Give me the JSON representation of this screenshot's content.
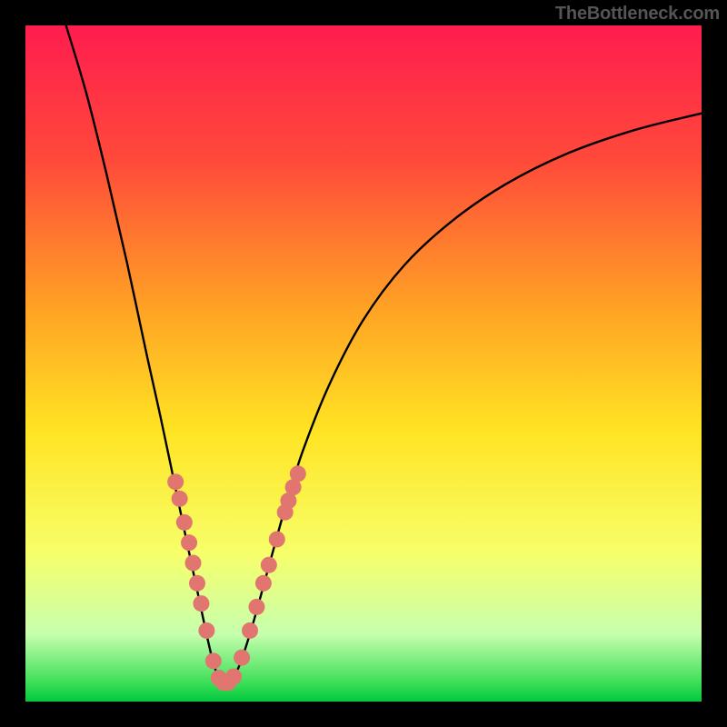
{
  "watermark": "TheBottleneck.com",
  "chart_data": {
    "type": "line",
    "title": "",
    "xlabel": "",
    "ylabel": "",
    "xlim": [
      0,
      100
    ],
    "ylim": [
      0,
      100
    ],
    "background_gradient": {
      "stops": [
        {
          "offset": 0,
          "color": "#ff1c4f"
        },
        {
          "offset": 20,
          "color": "#ff4a3a"
        },
        {
          "offset": 42,
          "color": "#ffa324"
        },
        {
          "offset": 60,
          "color": "#ffe423"
        },
        {
          "offset": 78,
          "color": "#f7ff6a"
        },
        {
          "offset": 90,
          "color": "#c7ffae"
        },
        {
          "offset": 97,
          "color": "#41e05a"
        },
        {
          "offset": 100,
          "color": "#00c93e"
        }
      ]
    },
    "curve": {
      "note": "Single V-shaped curve; y plotted with origin at top (0=top, 100=bottom). Minimum ~x=29.",
      "points": [
        {
          "x": 6.0,
          "y": 0.0
        },
        {
          "x": 9.0,
          "y": 10.0
        },
        {
          "x": 12.0,
          "y": 22.0
        },
        {
          "x": 15.0,
          "y": 35.0
        },
        {
          "x": 18.0,
          "y": 49.0
        },
        {
          "x": 20.0,
          "y": 58.0
        },
        {
          "x": 22.0,
          "y": 67.5
        },
        {
          "x": 24.0,
          "y": 77.0
        },
        {
          "x": 25.5,
          "y": 84.0
        },
        {
          "x": 27.0,
          "y": 91.0
        },
        {
          "x": 28.0,
          "y": 95.0
        },
        {
          "x": 29.0,
          "y": 97.0
        },
        {
          "x": 30.0,
          "y": 97.0
        },
        {
          "x": 31.5,
          "y": 95.0
        },
        {
          "x": 33.5,
          "y": 89.0
        },
        {
          "x": 36.0,
          "y": 80.0
        },
        {
          "x": 38.5,
          "y": 71.0
        },
        {
          "x": 41.0,
          "y": 63.0
        },
        {
          "x": 45.0,
          "y": 53.0
        },
        {
          "x": 50.0,
          "y": 43.5
        },
        {
          "x": 56.0,
          "y": 35.5
        },
        {
          "x": 63.0,
          "y": 29.0
        },
        {
          "x": 71.0,
          "y": 23.5
        },
        {
          "x": 80.0,
          "y": 19.0
        },
        {
          "x": 90.0,
          "y": 15.5
        },
        {
          "x": 100.0,
          "y": 13.0
        }
      ]
    },
    "markers": {
      "color": "#e0766f",
      "radius_px": 9,
      "points": [
        {
          "x": 22.2,
          "y": 67.5
        },
        {
          "x": 22.8,
          "y": 70.0
        },
        {
          "x": 23.5,
          "y": 73.5
        },
        {
          "x": 24.2,
          "y": 76.5
        },
        {
          "x": 24.8,
          "y": 79.5
        },
        {
          "x": 25.4,
          "y": 82.5
        },
        {
          "x": 26.0,
          "y": 85.5
        },
        {
          "x": 26.8,
          "y": 89.5
        },
        {
          "x": 27.8,
          "y": 94.0
        },
        {
          "x": 28.6,
          "y": 96.5
        },
        {
          "x": 29.3,
          "y": 97.2
        },
        {
          "x": 30.0,
          "y": 97.2
        },
        {
          "x": 30.8,
          "y": 96.3
        },
        {
          "x": 32.0,
          "y": 93.5
        },
        {
          "x": 33.2,
          "y": 89.5
        },
        {
          "x": 34.2,
          "y": 86.0
        },
        {
          "x": 35.2,
          "y": 82.5
        },
        {
          "x": 36.0,
          "y": 79.8
        },
        {
          "x": 37.2,
          "y": 76.0
        },
        {
          "x": 38.4,
          "y": 72.0
        },
        {
          "x": 38.9,
          "y": 70.3
        },
        {
          "x": 39.6,
          "y": 68.3
        },
        {
          "x": 40.3,
          "y": 66.3
        }
      ]
    }
  }
}
